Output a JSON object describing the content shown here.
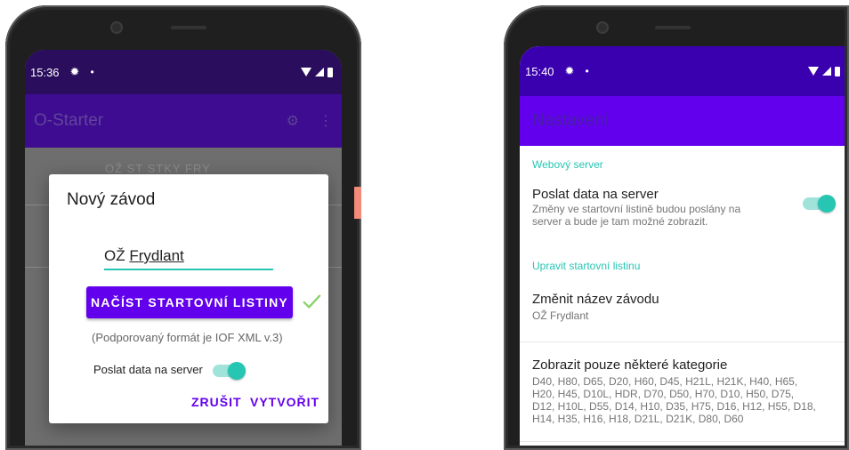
{
  "left_phone": {
    "status": {
      "time": "15:36",
      "gear_icon": "settings-icon",
      "dot": "•"
    },
    "app_title": "O-Starter",
    "list_header_partial": "OŽ ST STKY FRY",
    "dialog": {
      "title": "Nový závod",
      "race_name_value_prefix": "OŽ ",
      "race_name_value_underlined": "Frydlant",
      "load_button": "NAČÍST STARTOVNÍ LISTINY",
      "format_hint": "(Podporovaný formát je IOF XML v.3)",
      "send_toggle_label": "Poslat data na server",
      "send_toggle_on": true,
      "cancel": "ZRUŠIT",
      "create": "VYTVOŘIT"
    }
  },
  "right_phone": {
    "status": {
      "time": "15:40",
      "dot": "•"
    },
    "app_title": "Nastavení",
    "sections": [
      {
        "header": "Webový server",
        "pref_title": "Poslat data na server",
        "pref_summary_l1": "Změny ve startovní listině budou poslány na",
        "pref_summary_l2": "server a bude je tam možné zobrazit.",
        "toggle_on": true
      },
      {
        "header": "Upravit startovní listinu",
        "items": [
          {
            "title": "Změnit název závodu",
            "summary": "OŽ Frydlant"
          },
          {
            "title": "Zobrazit pouze některé kategorie",
            "summary_l1": "D40, H80, D65, D20, H60, D45, H21L, H21K, H40, H65,",
            "summary_l2": "H20, H45, D10L, HDR, D70, D50, H70, D10, H50, D75,",
            "summary_l3": "D12, H10L, D55, D14, H10, D35, H75, D16, H12, H55, D18,",
            "summary_l4": "H14, H35, H16, H18, D21L, D21K, D80, D60"
          }
        ]
      }
    ]
  },
  "colors": {
    "primary": "#6200ee",
    "accent": "#26c6b3",
    "status_left": "#2a0d5c",
    "status_right": "#3a00b0"
  }
}
